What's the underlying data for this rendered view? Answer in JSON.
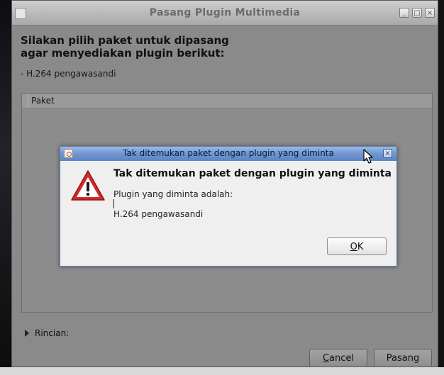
{
  "main_window": {
    "title": "Pasang Plugin Multimedia",
    "heading_line1": "Silakan pilih paket untuk dipasang",
    "heading_line2": "agar menyediakan plugin berikut:",
    "required_item": "- H.264 pengawasandi",
    "list_column": "Paket",
    "details_expander": "Rincian:",
    "cancel_label_prefix": "",
    "cancel_mnemonic": "C",
    "cancel_label_rest": "ancel",
    "install_label": "Pasang",
    "window_buttons": [
      "_",
      "□",
      "×"
    ]
  },
  "dialog": {
    "title": "Tak ditemukan paket dengan plugin yang diminta",
    "heading": "Tak ditemukan paket dengan plugin yang diminta",
    "message_line1": "Plugin yang diminta adalah:",
    "message_line2": "H.264 pengawasandi",
    "ok_mnemonic": "O",
    "ok_rest": "K",
    "close_symbol": "×",
    "icon": "warning-icon"
  },
  "colors": {
    "dialog_titlebar": "#6f96d1",
    "warning_red": "#d42a2a",
    "main_bg": "#8a8a8a"
  }
}
